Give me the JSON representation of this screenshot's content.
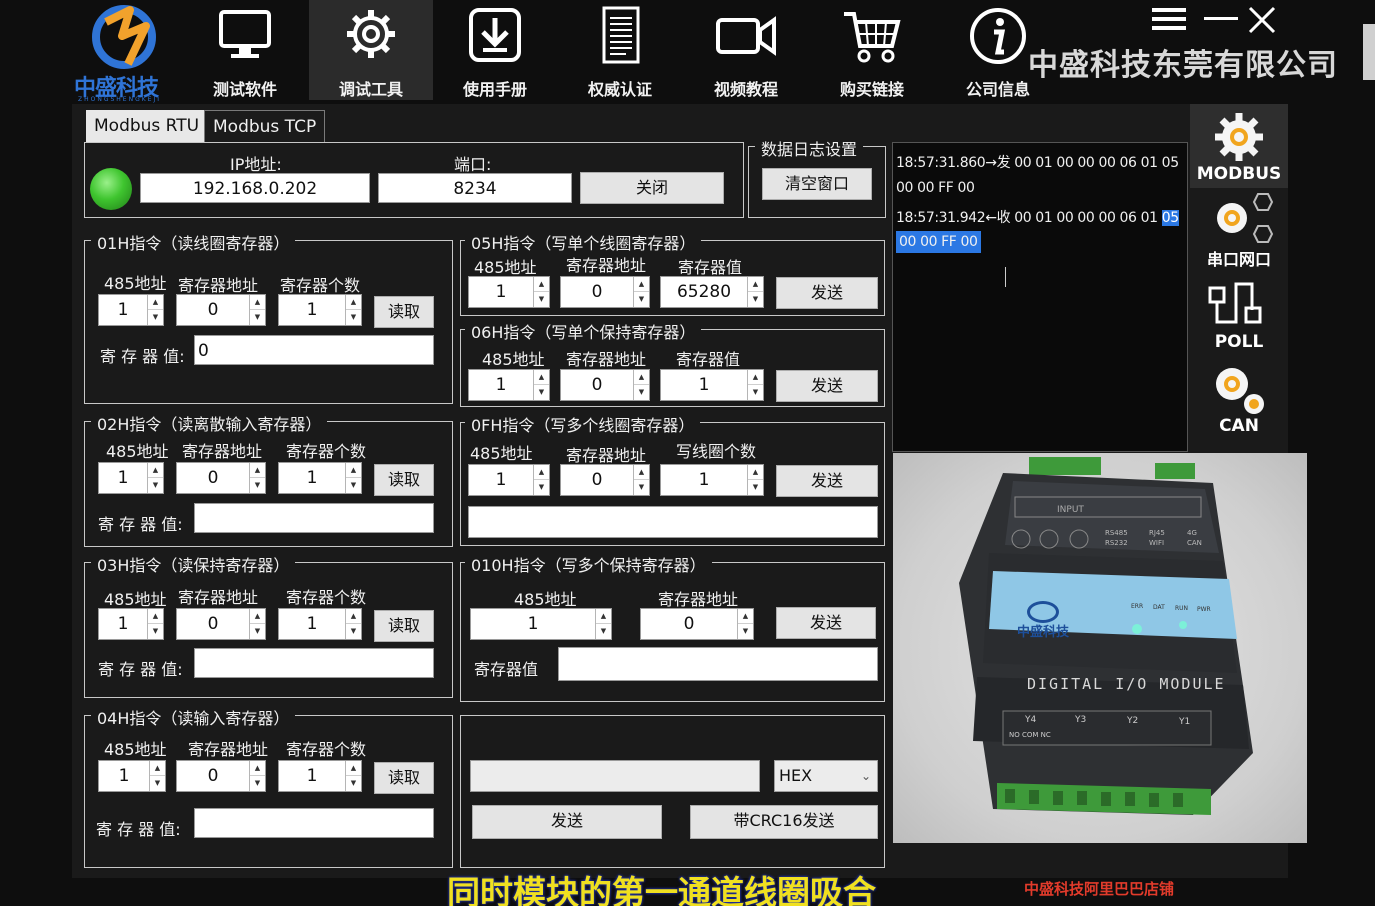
{
  "brand": {
    "name": "中盛科技",
    "subname": "ZHONGSHENGKEJI"
  },
  "nav": [
    {
      "label": "测试软件",
      "icon": "monitor-icon"
    },
    {
      "label": "调试工具",
      "icon": "gear-icon"
    },
    {
      "label": "使用手册",
      "icon": "download-icon"
    },
    {
      "label": "权威认证",
      "icon": "document-icon"
    },
    {
      "label": "视频教程",
      "icon": "video-camera-icon"
    },
    {
      "label": "购买链接",
      "icon": "shopping-cart-icon"
    },
    {
      "label": "公司信息",
      "icon": "info-icon"
    }
  ],
  "company": "中盛科技东莞有限公司",
  "tabs": [
    "Modbus RTU",
    "Modbus TCP"
  ],
  "connection": {
    "ip_label": "IP地址:",
    "ip_value": "192.168.0.202",
    "port_label": "端口:",
    "port_value": "8234",
    "close_label": "关闭",
    "status_color": "#3fc52f"
  },
  "log_settings": {
    "title": "数据日志设置",
    "clear_label": "清空窗口"
  },
  "log": {
    "line1": "18:57:31.860→发 00 01 00 00 00 06 01 05",
    "line2": "00 00 FF 00",
    "line3_prefix": "18:57:31.942←收 00 01 00 00 00 06 01 ",
    "line3_highlight": "05",
    "line4_highlight": "00 00 FF 00"
  },
  "side": [
    {
      "label": "MODBUS",
      "icon": "gear-icon"
    },
    {
      "label": "串口网口",
      "icon": "gear-network-icon"
    },
    {
      "label": "POLL",
      "icon": "poll-icon"
    },
    {
      "label": "CAN",
      "icon": "gears-icon"
    }
  ],
  "f01": {
    "title": "01H指令（读线圈寄存器）",
    "addr_label": "485地址",
    "reg_label": "寄存器地址",
    "count_label": "寄存器个数",
    "addr": "1",
    "reg": "0",
    "count": "1",
    "read_label": "读取",
    "value_label": "寄 存 器 值:",
    "value": "0"
  },
  "f02": {
    "title": "02H指令（读离散输入寄存器）",
    "addr_label": "485地址",
    "reg_label": "寄存器地址",
    "count_label": "寄存器个数",
    "addr": "1",
    "reg": "0",
    "count": "1",
    "read_label": "读取",
    "value_label": "寄 存 器 值:",
    "value": ""
  },
  "f03": {
    "title": "03H指令（读保持寄存器）",
    "addr_label": "485地址",
    "reg_label": "寄存器地址",
    "count_label": "寄存器个数",
    "addr": "1",
    "reg": "0",
    "count": "1",
    "read_label": "读取",
    "value_label": "寄 存 器 值:",
    "value": ""
  },
  "f04": {
    "title": "04H指令（读输入寄存器）",
    "addr_label": "485地址",
    "reg_label": "寄存器地址",
    "count_label": "寄存器个数",
    "addr": "1",
    "reg": "0",
    "count": "1",
    "read_label": "读取",
    "value_label": "寄 存 器 值:",
    "value": ""
  },
  "f05": {
    "title": "05H指令（写单个线圈寄存器）",
    "addr_label": "485地址",
    "reg_label": "寄存器地址",
    "val_label": "寄存器值",
    "addr": "1",
    "reg": "0",
    "val": "65280",
    "send_label": "发送"
  },
  "f06": {
    "title": "06H指令（写单个保持寄存器）",
    "addr_label": "485地址",
    "reg_label": "寄存器地址",
    "val_label": "寄存器值",
    "addr": "1",
    "reg": "0",
    "val": "1",
    "send_label": "发送"
  },
  "f0f": {
    "title": "0FH指令（写多个线圈寄存器）",
    "addr_label": "485地址",
    "reg_label": "寄存器地址",
    "val_label": "写线圈个数",
    "addr": "1",
    "reg": "0",
    "val": "1",
    "send_label": "发送",
    "data": ""
  },
  "f10": {
    "title": "010H指令（写多个保持寄存器）",
    "addr_label": "485地址",
    "reg_label": "寄存器地址",
    "addr": "1",
    "reg": "0",
    "send_label": "发送",
    "val_label": "寄存器值",
    "value": ""
  },
  "custom": {
    "input": "",
    "format": "HEX",
    "send_label": "发送",
    "crc_send_label": "带CRC16发送"
  },
  "photo": {
    "device_text": "DIGITAL I/O MODULE",
    "brand": "中盛科技",
    "relays": [
      "Y4",
      "Y3",
      "Y2",
      "Y1"
    ],
    "input_label": "INPUT",
    "port_tags": [
      "RS485",
      "RJ45",
      "RS232",
      "WIFI",
      "4G",
      "CAN"
    ],
    "led_labels": [
      "ERR",
      "DAT",
      "RUN",
      "PWR"
    ],
    "term_label": "NO COM NC"
  },
  "subtitle": "同时模块的第一通道线圈吸合",
  "shop": "中盛科技阿里巴巴店铺"
}
